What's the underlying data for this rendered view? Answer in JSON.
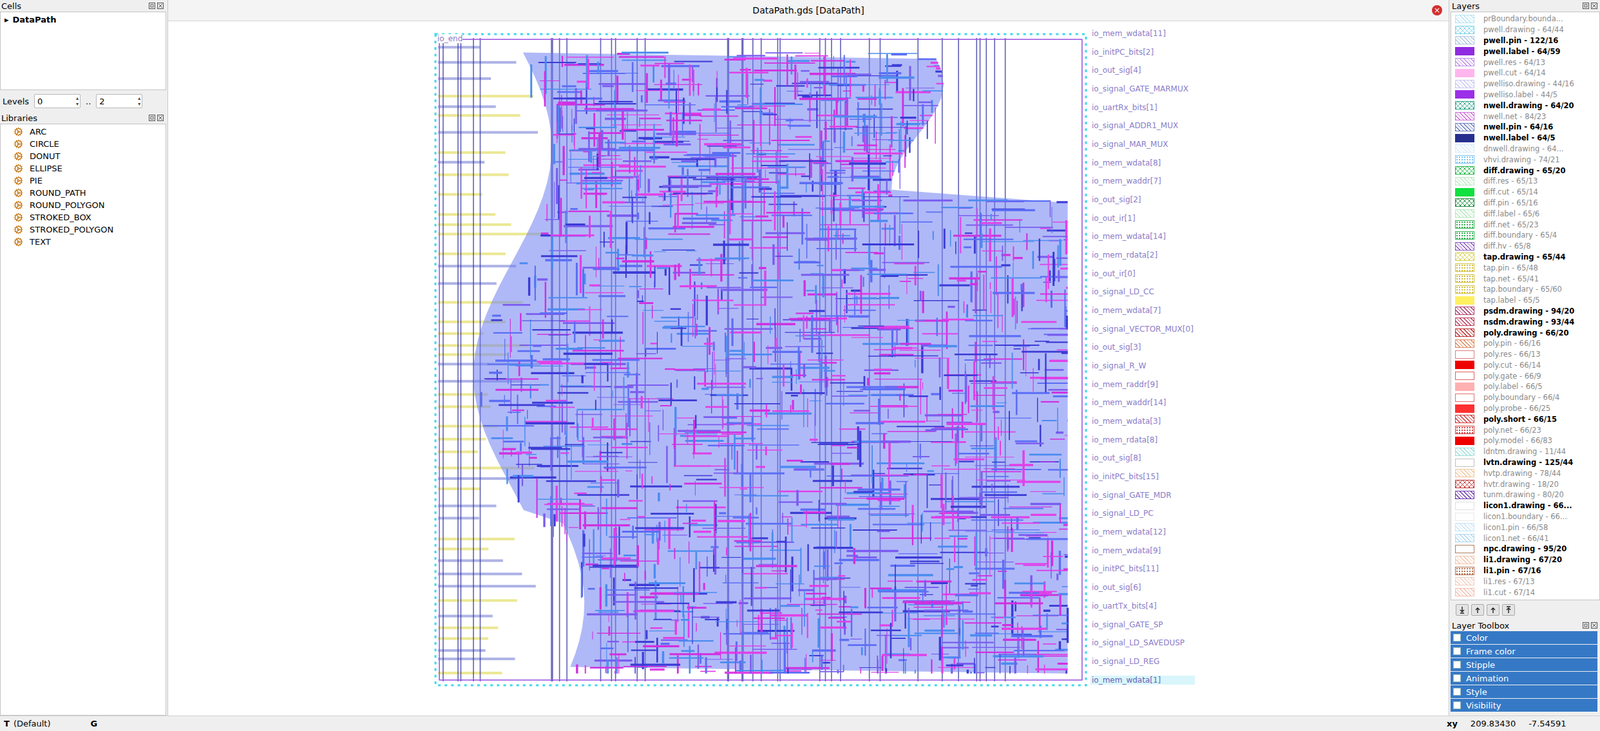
{
  "window": {
    "title": "DataPath.gds [DataPath]",
    "close": "×"
  },
  "cells": {
    "title": "Cells",
    "items": [
      {
        "label": "DataPath",
        "glyph": "▸",
        "expanded": false,
        "selected": false
      }
    ]
  },
  "levels": {
    "label": "Levels",
    "from": "0",
    "separator": "..",
    "to": "2",
    "spin_up": "▴",
    "spin_down": "▾"
  },
  "libraries": {
    "title": "Libraries",
    "items": [
      "ARC",
      "CIRCLE",
      "DONUT",
      "ELLIPSE",
      "PIE",
      "ROUND_PATH",
      "ROUND_POLYGON",
      "STROKED_BOX",
      "STROKED_POLYGON",
      "TEXT"
    ]
  },
  "layout": {
    "top_label": "io_end",
    "pins": [
      {
        "label": "io_mem_wdata[11]",
        "highlighted": false
      },
      {
        "label": "io_initPC_bits[2]",
        "highlighted": false
      },
      {
        "label": "io_out_sig[4]",
        "highlighted": false
      },
      {
        "label": "io_signal_GATE_MARMUX",
        "highlighted": false
      },
      {
        "label": "io_uartRx_bits[1]",
        "highlighted": false
      },
      {
        "label": "io_signal_ADDR1_MUX",
        "highlighted": false
      },
      {
        "label": "io_signal_MAR_MUX",
        "highlighted": false
      },
      {
        "label": "io_mem_wdata[8]",
        "highlighted": false
      },
      {
        "label": "io_mem_waddr[7]",
        "highlighted": false
      },
      {
        "label": "io_out_sig[2]",
        "highlighted": false
      },
      {
        "label": "io_out_ir[1]",
        "highlighted": false
      },
      {
        "label": "io_mem_wdata[14]",
        "highlighted": false
      },
      {
        "label": "io_mem_rdata[2]",
        "highlighted": false
      },
      {
        "label": "io_out_ir[0]",
        "highlighted": false
      },
      {
        "label": "io_signal_LD_CC",
        "highlighted": false
      },
      {
        "label": "io_mem_wdata[7]",
        "highlighted": false
      },
      {
        "label": "io_signal_VECTOR_MUX[0]",
        "highlighted": false
      },
      {
        "label": "io_out_sig[3]",
        "highlighted": false
      },
      {
        "label": "io_signal_R_W",
        "highlighted": false
      },
      {
        "label": "io_mem_raddr[9]",
        "highlighted": false
      },
      {
        "label": "io_mem_waddr[14]",
        "highlighted": false
      },
      {
        "label": "io_mem_wdata[3]",
        "highlighted": false
      },
      {
        "label": "io_mem_rdata[8]",
        "highlighted": false
      },
      {
        "label": "io_out_sig[8]",
        "highlighted": false
      },
      {
        "label": "io_initPC_bits[15]",
        "highlighted": false
      },
      {
        "label": "io_signal_GATE_MDR",
        "highlighted": false
      },
      {
        "label": "io_signal_LD_PC",
        "highlighted": false
      },
      {
        "label": "io_mem_wdata[12]",
        "highlighted": false
      },
      {
        "label": "io_mem_wdata[9]",
        "highlighted": false
      },
      {
        "label": "io_initPC_bits[11]",
        "highlighted": false
      },
      {
        "label": "io_out_sig[6]",
        "highlighted": false
      },
      {
        "label": "io_uartTx_bits[4]",
        "highlighted": false
      },
      {
        "label": "io_signal_GATE_SP",
        "highlighted": false
      },
      {
        "label": "io_signal_LD_SAVEDUSP",
        "highlighted": false
      },
      {
        "label": "io_signal_LD_REG",
        "highlighted": false
      },
      {
        "label": "io_mem_wdata[1]",
        "highlighted": true
      }
    ]
  },
  "layers": {
    "title": "Layers",
    "items": [
      {
        "name": "prBoundary.bounda...",
        "bold": false,
        "color": "#b8e4f4",
        "kind": "hatch"
      },
      {
        "name": "pwell.drawing - 64/44",
        "bold": false,
        "color": "#7fd4e6",
        "kind": "cross"
      },
      {
        "name": "pwell.pin - 122/16",
        "bold": true,
        "color": "#b0c8e0",
        "kind": "hatch"
      },
      {
        "name": "pwell.label - 64/59",
        "bold": true,
        "color": "#8f2be0",
        "kind": "solid"
      },
      {
        "name": "pwell.res - 64/13",
        "bold": false,
        "color": "#c090e8",
        "kind": "hatch"
      },
      {
        "name": "pwell.cut - 64/14",
        "bold": false,
        "color": "#ffb6ee",
        "kind": "solid"
      },
      {
        "name": "pwelliso.drawing - 44/16",
        "bold": false,
        "color": "#c8c8f0",
        "kind": "hatch"
      },
      {
        "name": "pwelliso.label - 44/5",
        "bold": false,
        "color": "#9b30e8",
        "kind": "solid"
      },
      {
        "name": "nwell.drawing - 64/20",
        "bold": true,
        "color": "#2ea58a",
        "kind": "cross"
      },
      {
        "name": "nwell.net - 84/23",
        "bold": false,
        "color": "#d070d8",
        "kind": "hatch"
      },
      {
        "name": "nwell.pin - 64/16",
        "bold": true,
        "color": "#7080c0",
        "kind": "hatch"
      },
      {
        "name": "nwell.label - 64/5",
        "bold": true,
        "color": "#27308f",
        "kind": "solid"
      },
      {
        "name": "dnwell.drawing - 64...",
        "bold": false,
        "color": "#d8ecfa",
        "kind": "hatch"
      },
      {
        "name": "vhvi.drawing - 74/21",
        "bold": false,
        "color": "#7cc4f4",
        "kind": "dots"
      },
      {
        "name": "diff.drawing - 65/20",
        "bold": true,
        "color": "#22b848",
        "kind": "cross"
      },
      {
        "name": "diff.res - 65/13",
        "bold": false,
        "color": "#bfe8c4",
        "kind": "hatch"
      },
      {
        "name": "diff.cut - 65/14",
        "bold": false,
        "color": "#10e040",
        "kind": "solid"
      },
      {
        "name": "diff.pin - 65/16",
        "bold": false,
        "color": "#208a40",
        "kind": "cross"
      },
      {
        "name": "diff.label - 65/6",
        "bold": false,
        "color": "#b8e8bc",
        "kind": "hatch"
      },
      {
        "name": "diff.net - 65/23",
        "bold": false,
        "color": "#30b050",
        "kind": "dots"
      },
      {
        "name": "diff.boundary - 65/4",
        "bold": false,
        "color": "#30b050",
        "kind": "dots"
      },
      {
        "name": "diff.hv - 65/8",
        "bold": false,
        "color": "#9060c0",
        "kind": "hatch"
      },
      {
        "name": "tap.drawing - 65/44",
        "bold": true,
        "color": "#d8d050",
        "kind": "cross"
      },
      {
        "name": "tap.pin - 65/48",
        "bold": false,
        "color": "#d0c040",
        "kind": "dots"
      },
      {
        "name": "tap.net - 65/41",
        "bold": false,
        "color": "#d0c040",
        "kind": "dots"
      },
      {
        "name": "tap.boundary - 65/60",
        "bold": false,
        "color": "#d0c040",
        "kind": "dots"
      },
      {
        "name": "tap.label - 65/5",
        "bold": false,
        "color": "#fff060",
        "kind": "solid"
      },
      {
        "name": "psdm.drawing - 94/20",
        "bold": true,
        "color": "#b04070",
        "kind": "hatch"
      },
      {
        "name": "nsdm.drawing - 93/44",
        "bold": true,
        "color": "#c04060",
        "kind": "hatch"
      },
      {
        "name": "poly.drawing - 66/20",
        "bold": true,
        "color": "#c03030",
        "kind": "hatch"
      },
      {
        "name": "poly.pin - 66/16",
        "bold": false,
        "color": "#e08a60",
        "kind": "hatch"
      },
      {
        "name": "poly.res - 66/13",
        "bold": false,
        "color": "#e08080",
        "kind": "empty"
      },
      {
        "name": "poly.cut - 66/14",
        "bold": false,
        "color": "#ee0000",
        "kind": "solid"
      },
      {
        "name": "poly.gate - 66/9",
        "bold": false,
        "color": "#e06060",
        "kind": "empty"
      },
      {
        "name": "poly.label - 66/5",
        "bold": false,
        "color": "#ffb0b0",
        "kind": "solid"
      },
      {
        "name": "poly.boundary - 66/4",
        "bold": false,
        "color": "#e07070",
        "kind": "empty"
      },
      {
        "name": "poly.probe - 66/25",
        "bold": false,
        "color": "#ff3030",
        "kind": "solid"
      },
      {
        "name": "poly.short - 66/15",
        "bold": true,
        "color": "#d04040",
        "kind": "hatch"
      },
      {
        "name": "poly.net - 66/23",
        "bold": false,
        "color": "#d04040",
        "kind": "dots"
      },
      {
        "name": "poly.model - 66/83",
        "bold": false,
        "color": "#ee0000",
        "kind": "solid"
      },
      {
        "name": "ldntm.drawing - 11/44",
        "bold": false,
        "color": "#a0dcdc",
        "kind": "hatch"
      },
      {
        "name": "lvtn.drawing - 125/44",
        "bold": true,
        "color": "#c0c0c0",
        "kind": "empty"
      },
      {
        "name": "hvtp.drawing - 78/44",
        "bold": false,
        "color": "#f0c8a0",
        "kind": "hatch"
      },
      {
        "name": "hvtr.drawing - 18/20",
        "bold": false,
        "color": "#c03a3a",
        "kind": "cross"
      },
      {
        "name": "tunm.drawing - 80/20",
        "bold": false,
        "color": "#7040b0",
        "kind": "hatch"
      },
      {
        "name": "licon1.drawing - 66...",
        "bold": true,
        "color": "#e0e0e0",
        "kind": "empty"
      },
      {
        "name": "licon1.boundary - 66...",
        "bold": false,
        "color": "#e8e8e8",
        "kind": "empty"
      },
      {
        "name": "licon1.pin - 66/58",
        "bold": false,
        "color": "#c8e4f8",
        "kind": "hatch"
      },
      {
        "name": "licon1.net - 66/41",
        "bold": false,
        "color": "#b0d8f0",
        "kind": "hatch"
      },
      {
        "name": "npc.drawing - 95/20",
        "bold": true,
        "color": "#b08060",
        "kind": "empty"
      },
      {
        "name": "li1.drawing - 67/20",
        "bold": true,
        "color": "#f0c8b0",
        "kind": "hatch"
      },
      {
        "name": "li1.pin - 67/16",
        "bold": true,
        "color": "#b07050",
        "kind": "dots"
      },
      {
        "name": "li1.res - 67/13",
        "bold": false,
        "color": "#f0d0c0",
        "kind": "hatch"
      },
      {
        "name": "li1.cut - 67/14",
        "bold": false,
        "color": "#f0c0b0",
        "kind": "hatch"
      }
    ]
  },
  "toolbox": {
    "title": "Layer Toolbox",
    "items": [
      "Color",
      "Frame color",
      "Stipple",
      "Animation",
      "Style",
      "Visibility"
    ]
  },
  "status_bar": {
    "mode": "T",
    "mode_label": "(Default)",
    "grid": "G",
    "coord_label": "xy",
    "x": "209.83430",
    "y": "-7.54591"
  }
}
